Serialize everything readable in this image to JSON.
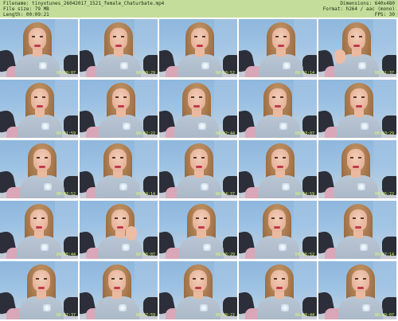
{
  "header": {
    "filename": "Filename: tinyxtunes_26042017_1521_female_Chaturbate.mp4",
    "filesize": "File size: 79 MB",
    "length": "Length: 00:09:21",
    "dimensions": "Dimensions: 640x480",
    "format": "Format: h264 / aac (mono)",
    "fps": "FPS: 30"
  },
  "thumbnails": [
    {
      "stamp": "00:00:07"
    },
    {
      "stamp": "00:00:29"
    },
    {
      "stamp": "00:00:52"
    },
    {
      "stamp": "00:01:14"
    },
    {
      "stamp": "00:01:37"
    },
    {
      "stamp": "00:01:59"
    },
    {
      "stamp": "00:02:22"
    },
    {
      "stamp": "00:02:44"
    },
    {
      "stamp": "00:03:07"
    },
    {
      "stamp": "00:03:29"
    },
    {
      "stamp": "00:03:52"
    },
    {
      "stamp": "00:04:14"
    },
    {
      "stamp": "00:04:37"
    },
    {
      "stamp": "00:04:59"
    },
    {
      "stamp": "00:05:22"
    },
    {
      "stamp": "00:05:44"
    },
    {
      "stamp": "00:06:07"
    },
    {
      "stamp": "00:06:29"
    },
    {
      "stamp": "00:06:52"
    },
    {
      "stamp": "00:07:14"
    },
    {
      "stamp": "00:07:37"
    },
    {
      "stamp": "00:07:59"
    },
    {
      "stamp": "00:08:22"
    },
    {
      "stamp": "00:08:44"
    },
    {
      "stamp": "00:09:07"
    }
  ]
}
